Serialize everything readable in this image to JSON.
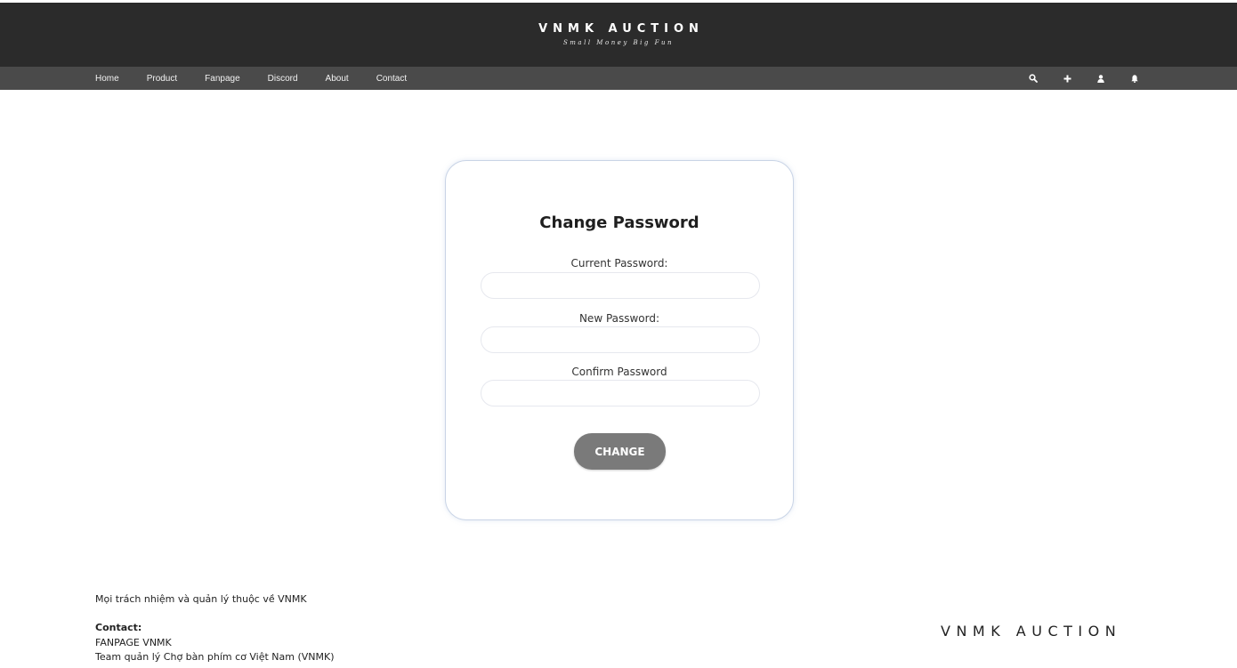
{
  "header": {
    "title": "VNMK AUCTION",
    "tagline": "Small Money Big Fun"
  },
  "nav": {
    "links": [
      "Home",
      "Product",
      "Fanpage",
      "Discord",
      "About",
      "Contact"
    ],
    "icons": [
      "search-icon",
      "plus-icon",
      "user-icon",
      "bell-icon"
    ]
  },
  "form": {
    "title": "Change Password",
    "current_label": "Current Password:",
    "current_value": "",
    "new_label": "New Password:",
    "new_value": "",
    "confirm_label": "Confirm Password",
    "confirm_value": "",
    "button_label": "CHANGE"
  },
  "footer": {
    "note": "Mọi trách nhiệm và quản lý thuộc về VNMK",
    "contact_heading": "Contact:",
    "contact_lines": [
      "FANPAGE VNMK",
      "Team quản lý Chợ bàn phím cơ Việt Nam (VNMK)"
    ],
    "brand": "VNMK AUCTION"
  },
  "colors": {
    "header_bg": "#2b2b2b",
    "nav_bg": "#4a4a4a",
    "button_bg": "#7a7a7a",
    "card_border": "#c9d4e6"
  }
}
